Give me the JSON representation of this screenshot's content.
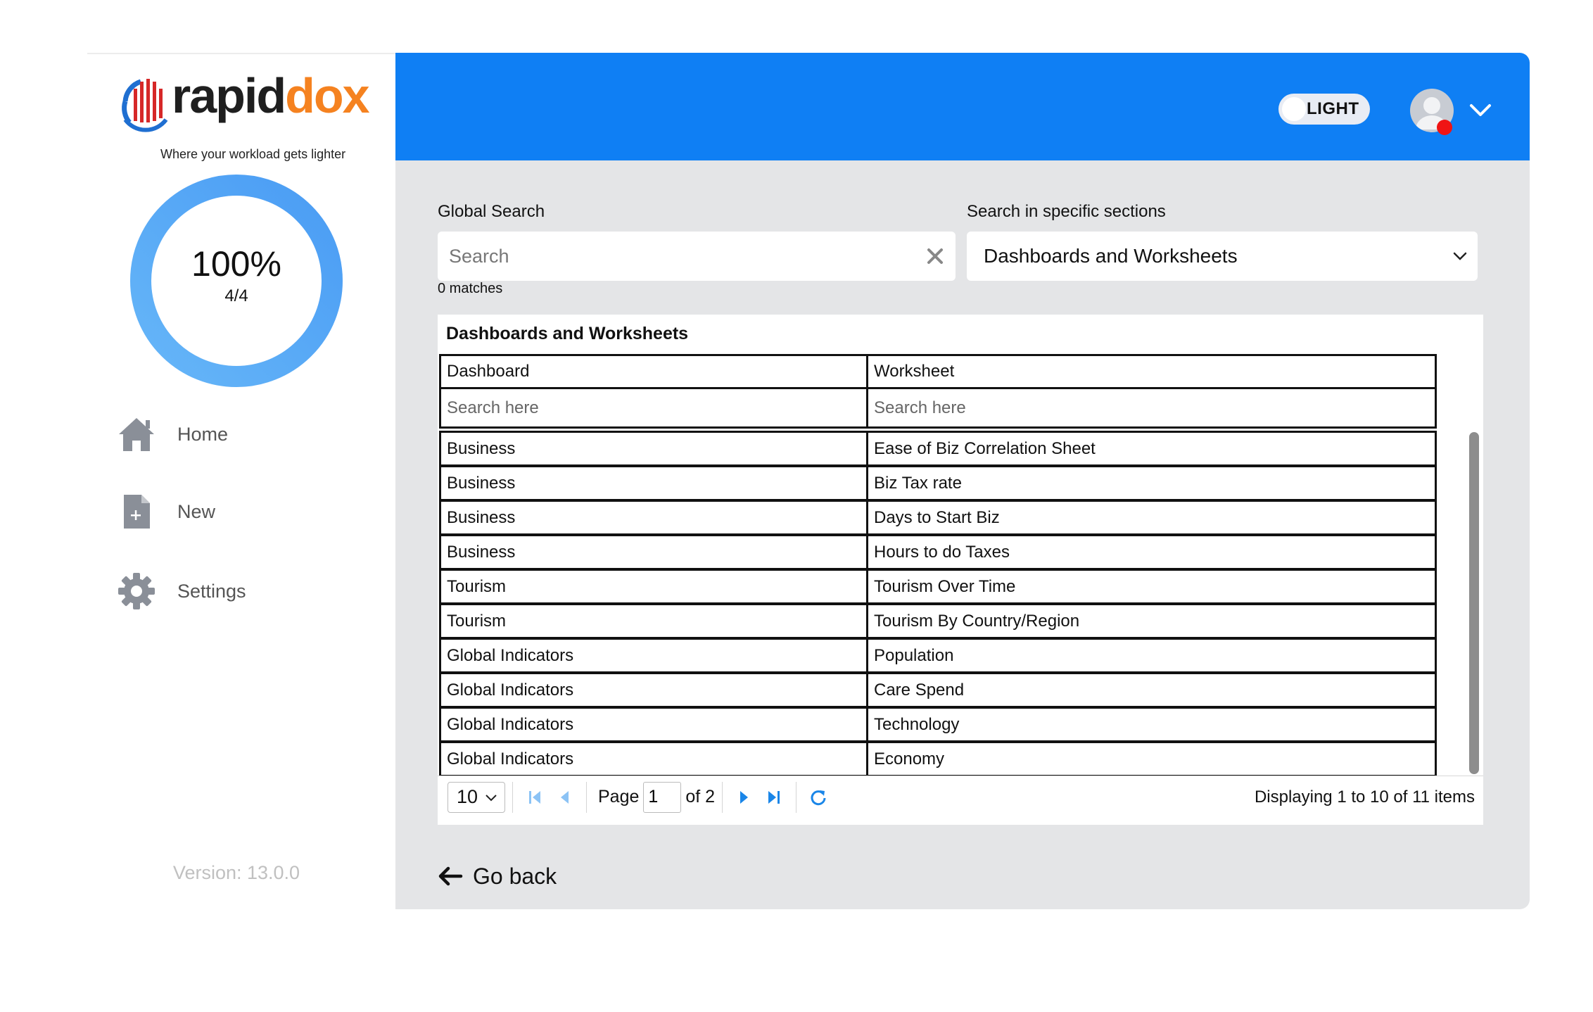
{
  "brand": {
    "name_main": "rapid",
    "name_accent": "dox",
    "tagline": "Where your workload gets lighter",
    "accent_color": "#f58220",
    "mark_colors": [
      "#1f6fd1",
      "#d62828"
    ]
  },
  "progress": {
    "percent_label": "100%",
    "fraction_label": "4/4",
    "fraction": 1.0,
    "color": "#52a8f7"
  },
  "sidebar": {
    "items": [
      {
        "label": "Home",
        "icon": "home-icon"
      },
      {
        "label": "New",
        "icon": "new-file-icon"
      },
      {
        "label": "Settings",
        "icon": "gear-icon"
      }
    ],
    "version": "Version: 13.0.0"
  },
  "header": {
    "bg_color": "#0f7ff4",
    "theme_toggle_label": "LIGHT",
    "notification_color": "#f01414"
  },
  "search": {
    "global_label": "Global Search",
    "placeholder": "Search",
    "value": "",
    "matches": "0 matches",
    "sections_label": "Search in specific sections",
    "selected_section": "Dashboards and Worksheets"
  },
  "grid": {
    "title": "Dashboards and Worksheets",
    "columns": [
      "Dashboard",
      "Worksheet"
    ],
    "filter_placeholder": "Search here",
    "rows": [
      [
        "Business",
        "Ease of Biz Correlation Sheet"
      ],
      [
        "Business",
        "Biz Tax rate"
      ],
      [
        "Business",
        "Days to Start Biz"
      ],
      [
        "Business",
        "Hours to do Taxes"
      ],
      [
        "Tourism",
        "Tourism Over Time"
      ],
      [
        "Tourism",
        "Tourism By Country/Region"
      ],
      [
        "Global Indicators",
        "Population"
      ],
      [
        "Global Indicators",
        "Care Spend"
      ],
      [
        "Global Indicators",
        "Technology"
      ],
      [
        "Global Indicators",
        "Economy"
      ]
    ]
  },
  "pager": {
    "page_size": "10",
    "page_label": "Page",
    "page_value": "1",
    "of_label": "of 2",
    "info": "Displaying 1 to 10 of 11 items",
    "button_color": "#1a86e8"
  },
  "go_back_label": "Go back"
}
